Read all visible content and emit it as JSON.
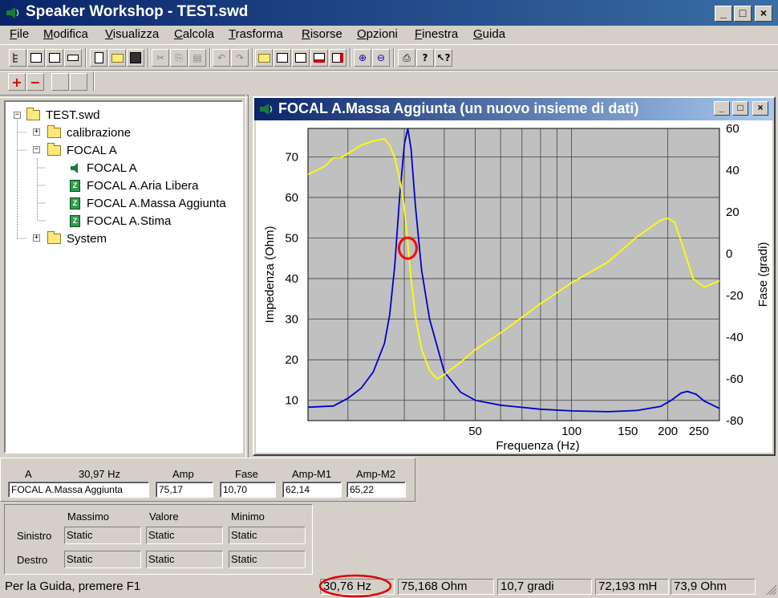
{
  "app": {
    "title": "Speaker Workshop - TEST.swd"
  },
  "menu": [
    "File",
    "Modifica",
    "Visualizza",
    "Calcola",
    "Trasforma",
    "Risorse",
    "Opzioni",
    "Finestra",
    "Guida"
  ],
  "tree": {
    "root": "TEST.swd",
    "items": [
      {
        "label": "calibrazione",
        "type": "folder",
        "expanded": false
      },
      {
        "label": "FOCAL A",
        "type": "folder",
        "expanded": true
      },
      {
        "label": "FOCAL A",
        "type": "speaker"
      },
      {
        "label": "FOCAL A.Aria Libera",
        "type": "z-data"
      },
      {
        "label": "FOCAL A.Massa Aggiunta",
        "type": "z-data"
      },
      {
        "label": "FOCAL A.Stima",
        "type": "z-data"
      },
      {
        "label": "System",
        "type": "folder",
        "expanded": false
      }
    ]
  },
  "child_window": {
    "title": "FOCAL A.Massa Aggiunta (un nuovo insieme di dati)"
  },
  "chart_data": {
    "type": "line",
    "xlabel": "Frequenza (Hz)",
    "ylabel": "Impedenza (Ohm)",
    "y2label": "Fase (gradi)",
    "x_scale": "log",
    "x_ticks": [
      "50",
      "100",
      "150",
      "200",
      "250"
    ],
    "y_ticks": [
      "10",
      "20",
      "30",
      "40",
      "50",
      "60",
      "70"
    ],
    "y2_ticks": [
      "60",
      "40",
      "20",
      "0",
      "-20",
      "-40",
      "-60",
      "-80"
    ],
    "ylim": [
      5,
      77
    ],
    "y2lim": [
      -80,
      60
    ],
    "xlim": [
      15,
      290
    ],
    "grid": true,
    "series": [
      {
        "name": "",
        "color": "#0000cc",
        "axis": "left",
        "x": [
          15,
          18,
          20,
          22,
          24,
          26,
          27,
          28,
          29,
          30,
          30.76,
          31.5,
          32.5,
          34,
          36,
          40,
          45,
          50,
          60,
          80,
          100,
          130,
          160,
          190,
          205,
          220,
          230,
          245,
          260,
          290
        ],
        "y": [
          8.3,
          8.6,
          10.5,
          13,
          17,
          24,
          31,
          43,
          60,
          73,
          77,
          72,
          58,
          42,
          30,
          17,
          12,
          10,
          8.8,
          7.8,
          7.4,
          7.2,
          7.5,
          8.5,
          10,
          11.8,
          12.2,
          11.5,
          9.8,
          8
        ]
      },
      {
        "name": "",
        "color": "#ffff00",
        "axis": "right",
        "x": [
          15,
          16,
          17,
          18,
          19,
          20,
          21,
          22,
          24,
          26,
          27,
          28,
          29,
          30,
          30.76,
          31.5,
          32.5,
          34,
          36,
          38,
          40,
          45,
          50,
          60,
          80,
          100,
          130,
          160,
          190,
          200,
          210,
          220,
          240,
          260,
          290
        ],
        "y": [
          38,
          40,
          42,
          46,
          46,
          48,
          50,
          52,
          54,
          55,
          52,
          46,
          36,
          22,
          5,
          -12,
          -30,
          -46,
          -56,
          -60,
          -58,
          -52,
          -46,
          -38,
          -24,
          -14,
          -4,
          8,
          16,
          17,
          15,
          6,
          -12,
          -16,
          -13
        ]
      }
    ],
    "marker": {
      "x": 30.76,
      "y": 47.5,
      "color": "#ff0000"
    }
  },
  "readout": {
    "col_a_header": "A",
    "freq_header": "30,97 Hz",
    "amp_header": "Amp",
    "fase_header": "Fase",
    "amp_m1_header": "Amp-M1",
    "amp_m2_header": "Amp-M2",
    "name_value": "FOCAL A.Massa Aggiunta",
    "amp_value": "75,17",
    "fase_value": "10,70",
    "amp_m1_value": "62,14",
    "amp_m2_value": "65,22"
  },
  "stats": {
    "headers": [
      "Massimo",
      "Valore",
      "Minimo"
    ],
    "rows": [
      {
        "label": "Sinistro",
        "values": [
          "Static",
          "Static",
          "Static"
        ]
      },
      {
        "label": "Destro",
        "values": [
          "Static",
          "Static",
          "Static"
        ]
      }
    ]
  },
  "status": {
    "help": "Per la Guida, premere F1",
    "freq": "30,76 Hz",
    "impedance": "75,168 Ohm",
    "phase": "10,7 gradi",
    "inductance": "72,193 mH",
    "ohm2": "73,9 Ohm"
  }
}
